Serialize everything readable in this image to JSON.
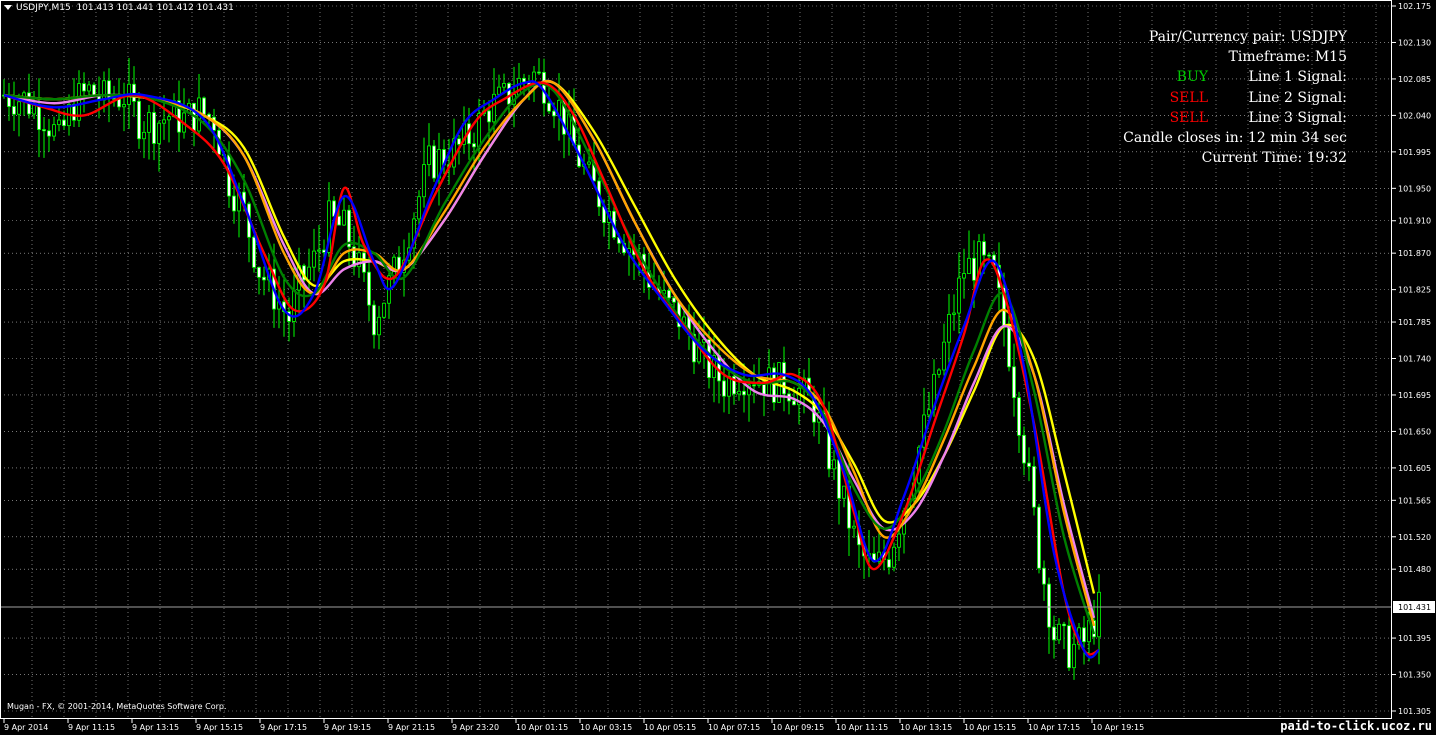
{
  "header": {
    "symbol_timeframe": "USDJPY,M15",
    "ohlc": "101.413 101.441 101.412 101.431"
  },
  "info_panel": {
    "pair": "Pair/Currency pair: USDJPY",
    "timeframe": "Timeframe: M15",
    "line1_label": "Line 1 Signal:",
    "line1_signal": "BUY",
    "line2_label": "Line 2 Signal:",
    "line2_signal": "SELL",
    "line3_label": "Line 3 Signal:",
    "line3_signal": "SELL",
    "candle_closes": "Candle closes in: 12 min 34 sec",
    "current_time": "Current Time: 19:32"
  },
  "copyright": "Mugan - FX, © 2001-2014, MetaQuotes Software Corp.",
  "watermark": "paid-to-click.ucoz.ru",
  "colors": {
    "background": "#000000",
    "grid": "#ffffff",
    "candle": "#00ff00",
    "buy": "#00c800",
    "sell": "#ff0000",
    "ma_blue": "#0000ff",
    "ma_red": "#ff0000",
    "ma_green": "#008000",
    "ma_orange": "#ffa500",
    "ma_violet": "#ee82ee",
    "ma_yellow": "#ffff00"
  },
  "chart_data": {
    "type": "candlestick",
    "symbol": "USDJPY",
    "timeframe": "M15",
    "ylim": [
      101.305,
      102.175
    ],
    "current_price": "101.431",
    "y_ticks": [
      "102.175",
      "102.130",
      "102.085",
      "102.040",
      "101.995",
      "101.950",
      "101.910",
      "101.870",
      "101.825",
      "101.785",
      "101.740",
      "101.695",
      "101.650",
      "101.605",
      "101.565",
      "101.520",
      "101.480",
      "101.395",
      "101.350",
      "101.305"
    ],
    "x_ticks": [
      "9 Apr 2014",
      "9 Apr 11:15",
      "9 Apr 13:15",
      "9 Apr 15:15",
      "9 Apr 17:15",
      "9 Apr 19:15",
      "9 Apr 21:15",
      "9 Apr 23:20",
      "10 Apr 01:15",
      "10 Apr 03:15",
      "10 Apr 05:15",
      "10 Apr 07:15",
      "10 Apr 09:15",
      "10 Apr 11:15",
      "10 Apr 13:15",
      "10 Apr 15:15",
      "10 Apr 17:15",
      "10 Apr 19:15"
    ],
    "close_path": [
      [
        0,
        102.065
      ],
      [
        4,
        102.06
      ],
      [
        8,
        102.04
      ],
      [
        11,
        102.01
      ],
      [
        14,
        102.055
      ],
      [
        17,
        102.07
      ],
      [
        20,
        102.06
      ],
      [
        24,
        102.065
      ],
      [
        27,
        102.035
      ],
      [
        30,
        102.03
      ],
      [
        33,
        102.04
      ],
      [
        36,
        102.035
      ],
      [
        39,
        102.045
      ],
      [
        42,
        102.035
      ],
      [
        45,
        101.96
      ],
      [
        48,
        101.92
      ],
      [
        51,
        101.85
      ],
      [
        54,
        101.82
      ],
      [
        57,
        101.79
      ],
      [
        59,
        101.83
      ],
      [
        62,
        101.86
      ],
      [
        65,
        101.91
      ],
      [
        68,
        101.9
      ],
      [
        71,
        101.85
      ],
      [
        74,
        101.79
      ],
      [
        77,
        101.83
      ],
      [
        79,
        101.86
      ],
      [
        82,
        101.92
      ],
      [
        85,
        101.98
      ],
      [
        88,
        101.99
      ],
      [
        91,
        102.0
      ],
      [
        94,
        102.02
      ],
      [
        97,
        102.05
      ],
      [
        100,
        102.06
      ],
      [
        103,
        102.08
      ],
      [
        106,
        102.09
      ],
      [
        108,
        102.08
      ],
      [
        111,
        102.05
      ],
      [
        114,
        102.0
      ],
      [
        117,
        101.96
      ],
      [
        120,
        101.93
      ],
      [
        123,
        101.9
      ],
      [
        126,
        101.87
      ],
      [
        129,
        101.84
      ],
      [
        132,
        101.81
      ],
      [
        135,
        101.79
      ],
      [
        138,
        101.76
      ],
      [
        141,
        101.73
      ],
      [
        144,
        101.71
      ],
      [
        147,
        101.72
      ],
      [
        150,
        101.72
      ],
      [
        153,
        101.71
      ],
      [
        156,
        101.71
      ],
      [
        159,
        101.7
      ],
      [
        162,
        101.68
      ],
      [
        165,
        101.62
      ],
      [
        168,
        101.56
      ],
      [
        171,
        101.5
      ],
      [
        174,
        101.48
      ],
      [
        177,
        101.5
      ],
      [
        180,
        101.56
      ],
      [
        183,
        101.63
      ],
      [
        186,
        101.7
      ],
      [
        189,
        101.78
      ],
      [
        192,
        101.85
      ],
      [
        195,
        101.86
      ],
      [
        198,
        101.84
      ],
      [
        201,
        101.75
      ],
      [
        204,
        101.63
      ],
      [
        207,
        101.5
      ],
      [
        210,
        101.4
      ],
      [
        213,
        101.38
      ],
      [
        216,
        101.39
      ],
      [
        219,
        101.43
      ]
    ],
    "series": [
      {
        "name": "blue",
        "color": "#0000ff",
        "points": [
          [
            0,
            102.065
          ],
          [
            10,
            102.05
          ],
          [
            20,
            102.06
          ],
          [
            28,
            102.065
          ],
          [
            40,
            102.035
          ],
          [
            48,
            101.93
          ],
          [
            56,
            101.8
          ],
          [
            62,
            101.82
          ],
          [
            68,
            101.94
          ],
          [
            74,
            101.86
          ],
          [
            78,
            101.83
          ],
          [
            86,
            101.95
          ],
          [
            92,
            102.03
          ],
          [
            98,
            102.06
          ],
          [
            104,
            102.08
          ],
          [
            108,
            102.07
          ],
          [
            116,
            101.98
          ],
          [
            124,
            101.88
          ],
          [
            132,
            101.81
          ],
          [
            140,
            101.75
          ],
          [
            148,
            101.72
          ],
          [
            156,
            101.72
          ],
          [
            162,
            101.69
          ],
          [
            168,
            101.6
          ],
          [
            174,
            101.49
          ],
          [
            180,
            101.57
          ],
          [
            186,
            101.68
          ],
          [
            192,
            101.78
          ],
          [
            198,
            101.86
          ],
          [
            204,
            101.73
          ],
          [
            210,
            101.5
          ],
          [
            216,
            101.38
          ],
          [
            219,
            101.38
          ]
        ]
      },
      {
        "name": "red",
        "color": "#ff0000",
        "points": [
          [
            0,
            102.065
          ],
          [
            8,
            102.05
          ],
          [
            16,
            102.04
          ],
          [
            26,
            102.065
          ],
          [
            36,
            102.03
          ],
          [
            44,
            101.98
          ],
          [
            52,
            101.87
          ],
          [
            58,
            101.8
          ],
          [
            64,
            101.83
          ],
          [
            68,
            101.95
          ],
          [
            72,
            101.88
          ],
          [
            78,
            101.84
          ],
          [
            86,
            101.94
          ],
          [
            94,
            102.03
          ],
          [
            100,
            102.06
          ],
          [
            108,
            102.08
          ],
          [
            114,
            102.04
          ],
          [
            120,
            101.96
          ],
          [
            128,
            101.85
          ],
          [
            136,
            101.78
          ],
          [
            144,
            101.72
          ],
          [
            152,
            101.71
          ],
          [
            158,
            101.72
          ],
          [
            164,
            101.68
          ],
          [
            170,
            101.55
          ],
          [
            174,
            101.48
          ],
          [
            180,
            101.55
          ],
          [
            186,
            101.66
          ],
          [
            192,
            101.77
          ],
          [
            196,
            101.86
          ],
          [
            200,
            101.82
          ],
          [
            206,
            101.66
          ],
          [
            212,
            101.45
          ],
          [
            216,
            101.38
          ],
          [
            219,
            101.38
          ]
        ]
      },
      {
        "name": "green",
        "color": "#008000",
        "points": [
          [
            0,
            102.065
          ],
          [
            10,
            102.06
          ],
          [
            20,
            102.065
          ],
          [
            30,
            102.06
          ],
          [
            40,
            102.03
          ],
          [
            48,
            101.96
          ],
          [
            56,
            101.84
          ],
          [
            62,
            101.82
          ],
          [
            68,
            101.88
          ],
          [
            74,
            101.87
          ],
          [
            80,
            101.84
          ],
          [
            88,
            101.93
          ],
          [
            96,
            102.01
          ],
          [
            104,
            102.07
          ],
          [
            110,
            102.07
          ],
          [
            118,
            101.98
          ],
          [
            126,
            101.88
          ],
          [
            134,
            101.8
          ],
          [
            142,
            101.74
          ],
          [
            150,
            101.71
          ],
          [
            158,
            101.71
          ],
          [
            164,
            101.67
          ],
          [
            170,
            101.58
          ],
          [
            176,
            101.53
          ],
          [
            182,
            101.57
          ],
          [
            188,
            101.65
          ],
          [
            194,
            101.75
          ],
          [
            200,
            101.82
          ],
          [
            206,
            101.7
          ],
          [
            212,
            101.52
          ],
          [
            218,
            101.4
          ]
        ]
      },
      {
        "name": "orange",
        "color": "#ffa500",
        "points": [
          [
            0,
            102.065
          ],
          [
            10,
            102.06
          ],
          [
            20,
            102.065
          ],
          [
            30,
            102.06
          ],
          [
            40,
            102.04
          ],
          [
            48,
            101.99
          ],
          [
            56,
            101.87
          ],
          [
            62,
            101.82
          ],
          [
            68,
            101.87
          ],
          [
            74,
            101.87
          ],
          [
            80,
            101.85
          ],
          [
            88,
            101.92
          ],
          [
            96,
            102.0
          ],
          [
            104,
            102.06
          ],
          [
            110,
            102.08
          ],
          [
            118,
            102.01
          ],
          [
            126,
            101.91
          ],
          [
            134,
            101.82
          ],
          [
            142,
            101.76
          ],
          [
            150,
            101.72
          ],
          [
            158,
            101.71
          ],
          [
            164,
            101.68
          ],
          [
            170,
            101.6
          ],
          [
            176,
            101.52
          ],
          [
            182,
            101.56
          ],
          [
            188,
            101.64
          ],
          [
            194,
            101.73
          ],
          [
            200,
            101.8
          ],
          [
            206,
            101.72
          ],
          [
            212,
            101.55
          ],
          [
            218,
            101.41
          ]
        ]
      },
      {
        "name": "violet",
        "color": "#ee82ee",
        "points": [
          [
            0,
            102.065
          ],
          [
            10,
            102.055
          ],
          [
            20,
            102.065
          ],
          [
            30,
            102.06
          ],
          [
            40,
            102.04
          ],
          [
            48,
            101.99
          ],
          [
            56,
            101.88
          ],
          [
            62,
            101.82
          ],
          [
            68,
            101.85
          ],
          [
            74,
            101.86
          ],
          [
            80,
            101.85
          ],
          [
            88,
            101.91
          ],
          [
            96,
            101.99
          ],
          [
            104,
            102.06
          ],
          [
            110,
            102.08
          ],
          [
            118,
            102.01
          ],
          [
            126,
            101.91
          ],
          [
            134,
            101.82
          ],
          [
            142,
            101.75
          ],
          [
            150,
            101.7
          ],
          [
            158,
            101.69
          ],
          [
            164,
            101.66
          ],
          [
            170,
            101.59
          ],
          [
            176,
            101.53
          ],
          [
            182,
            101.55
          ],
          [
            188,
            101.62
          ],
          [
            194,
            101.71
          ],
          [
            200,
            101.78
          ],
          [
            206,
            101.72
          ],
          [
            212,
            101.56
          ],
          [
            218,
            101.42
          ]
        ]
      },
      {
        "name": "yellow",
        "color": "#ffff00",
        "points": [
          [
            0,
            102.065
          ],
          [
            10,
            102.06
          ],
          [
            20,
            102.065
          ],
          [
            30,
            102.06
          ],
          [
            40,
            102.04
          ],
          [
            48,
            102.0
          ],
          [
            56,
            101.89
          ],
          [
            62,
            101.83
          ],
          [
            68,
            101.86
          ],
          [
            74,
            101.86
          ],
          [
            80,
            101.85
          ],
          [
            88,
            101.91
          ],
          [
            96,
            101.99
          ],
          [
            104,
            102.06
          ],
          [
            110,
            102.08
          ],
          [
            118,
            102.02
          ],
          [
            126,
            101.93
          ],
          [
            134,
            101.84
          ],
          [
            142,
            101.77
          ],
          [
            150,
            101.72
          ],
          [
            158,
            101.7
          ],
          [
            164,
            101.67
          ],
          [
            170,
            101.61
          ],
          [
            176,
            101.54
          ],
          [
            182,
            101.56
          ],
          [
            188,
            101.62
          ],
          [
            194,
            101.7
          ],
          [
            200,
            101.78
          ],
          [
            206,
            101.74
          ],
          [
            212,
            101.6
          ],
          [
            218,
            101.45
          ]
        ]
      }
    ]
  }
}
